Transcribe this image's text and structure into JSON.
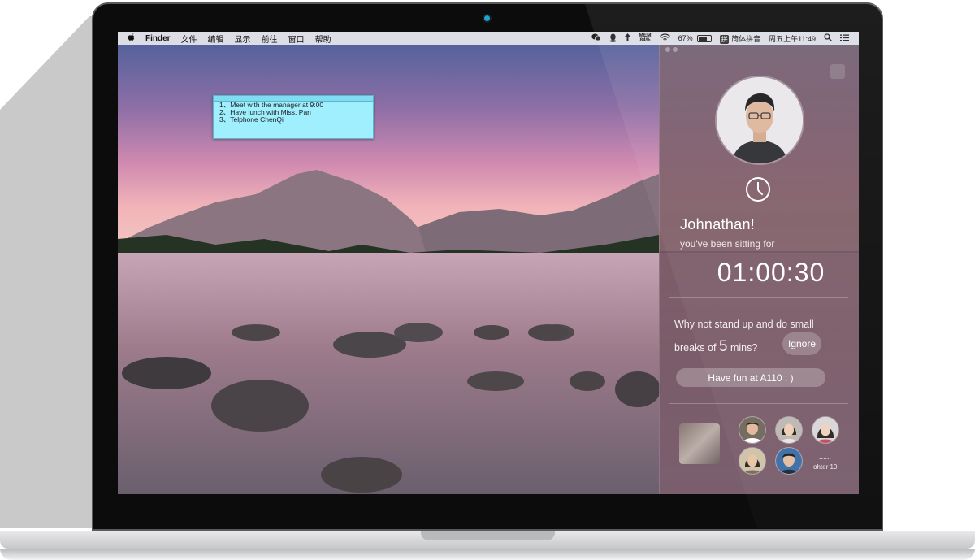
{
  "menubar": {
    "apple_icon": "apple-icon",
    "app_name": "Finder",
    "menus": [
      "文件",
      "编辑",
      "显示",
      "前往",
      "窗口",
      "帮助"
    ],
    "mem_label": "MEM",
    "mem_value": "84%",
    "battery": "67%",
    "battery_level": 0.67,
    "input_method_badge": "拼",
    "input_method": "简体拼音",
    "clock": "周五上午11:49"
  },
  "sticky": {
    "lines": [
      "1、Meet with the manager at 9:00",
      "2、Have lunch with Miss. Pan",
      "3、Telphone ChenQi"
    ]
  },
  "panel": {
    "greeting": "Johnathan!",
    "sitting_text": "you've been sitting for",
    "timer": "01:00:30",
    "suggest_line1": "Why not stand up and do small",
    "suggest_prefix": "breaks of",
    "suggest_number": "5",
    "suggest_suffix": "mins?",
    "ignore_label": "Ignore",
    "fun_label": "Have fun at A110 : )",
    "more_dots": "......",
    "others_label": "ohter 10"
  }
}
